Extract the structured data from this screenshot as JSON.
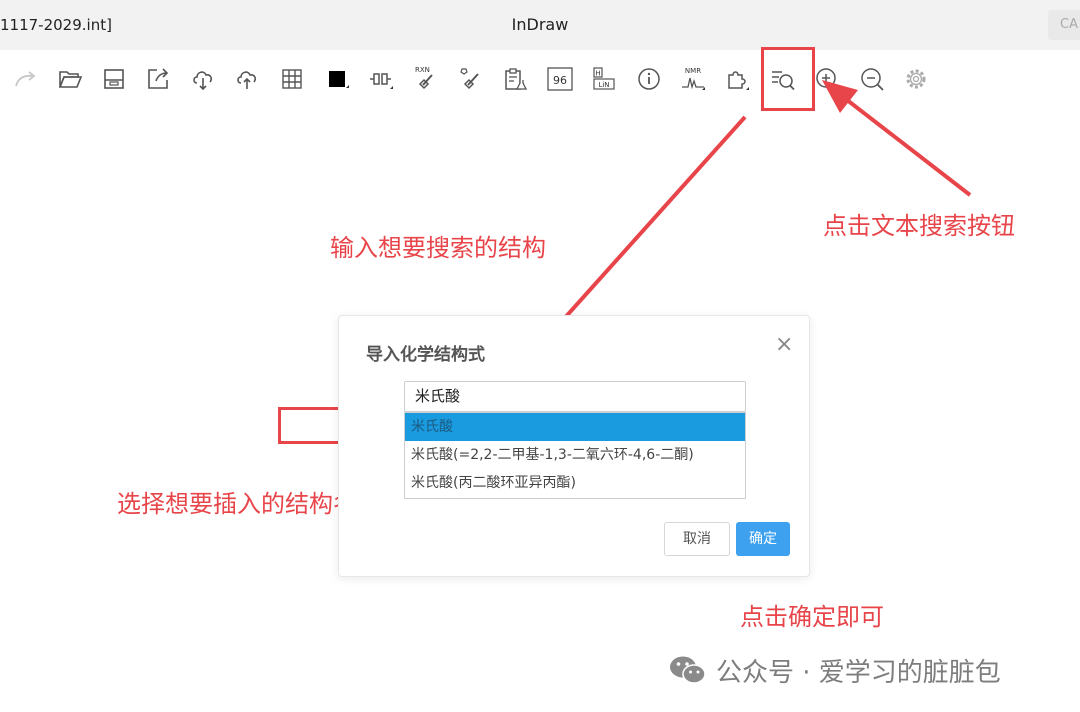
{
  "window": {
    "file_name": "1117-2029.int]",
    "title": "InDraw",
    "corner_button": "CA"
  },
  "toolbar": {
    "icons": [
      "redo-icon",
      "open-folder-icon",
      "save-icon",
      "export-icon",
      "cloud-download-icon",
      "cloud-upload-icon",
      "grid-icon",
      "color-fill-icon",
      "bond-tool-icon",
      "reaction-clean-icon",
      "structure-clean-icon",
      "clipboard-flask-icon",
      "number-96-icon",
      "h-ln-table-icon",
      "info-icon",
      "nmr-icon",
      "plugin-icon",
      "text-search-icon",
      "zoom-in-icon",
      "zoom-out-icon",
      "settings-icon"
    ],
    "label_96": "96",
    "label_rxn": "RXN",
    "label_nmr": "NMR",
    "label_h": "H",
    "label_ln": "LiN"
  },
  "dialog": {
    "title": "导入化学结构式",
    "close_symbol": "×",
    "search_value": "米氏酸",
    "options": [
      "米氏酸",
      "米氏酸(=2,2-二甲基-1,3-二氧六环-4,6-二酮)",
      "米氏酸(丙二酸环亚异丙酯)"
    ],
    "selected_index": 0,
    "cancel_label": "取消",
    "confirm_label": "确定"
  },
  "annotations": {
    "input_hint": "输入想要搜索的结构",
    "search_button_hint": "点击文本搜索按钮",
    "select_hint": "选择想要插入的结构名称",
    "confirm_hint": "点击确定即可",
    "color": "#e8454a"
  },
  "watermark": {
    "text": "公众号 · 爱学习的脏脏包"
  }
}
